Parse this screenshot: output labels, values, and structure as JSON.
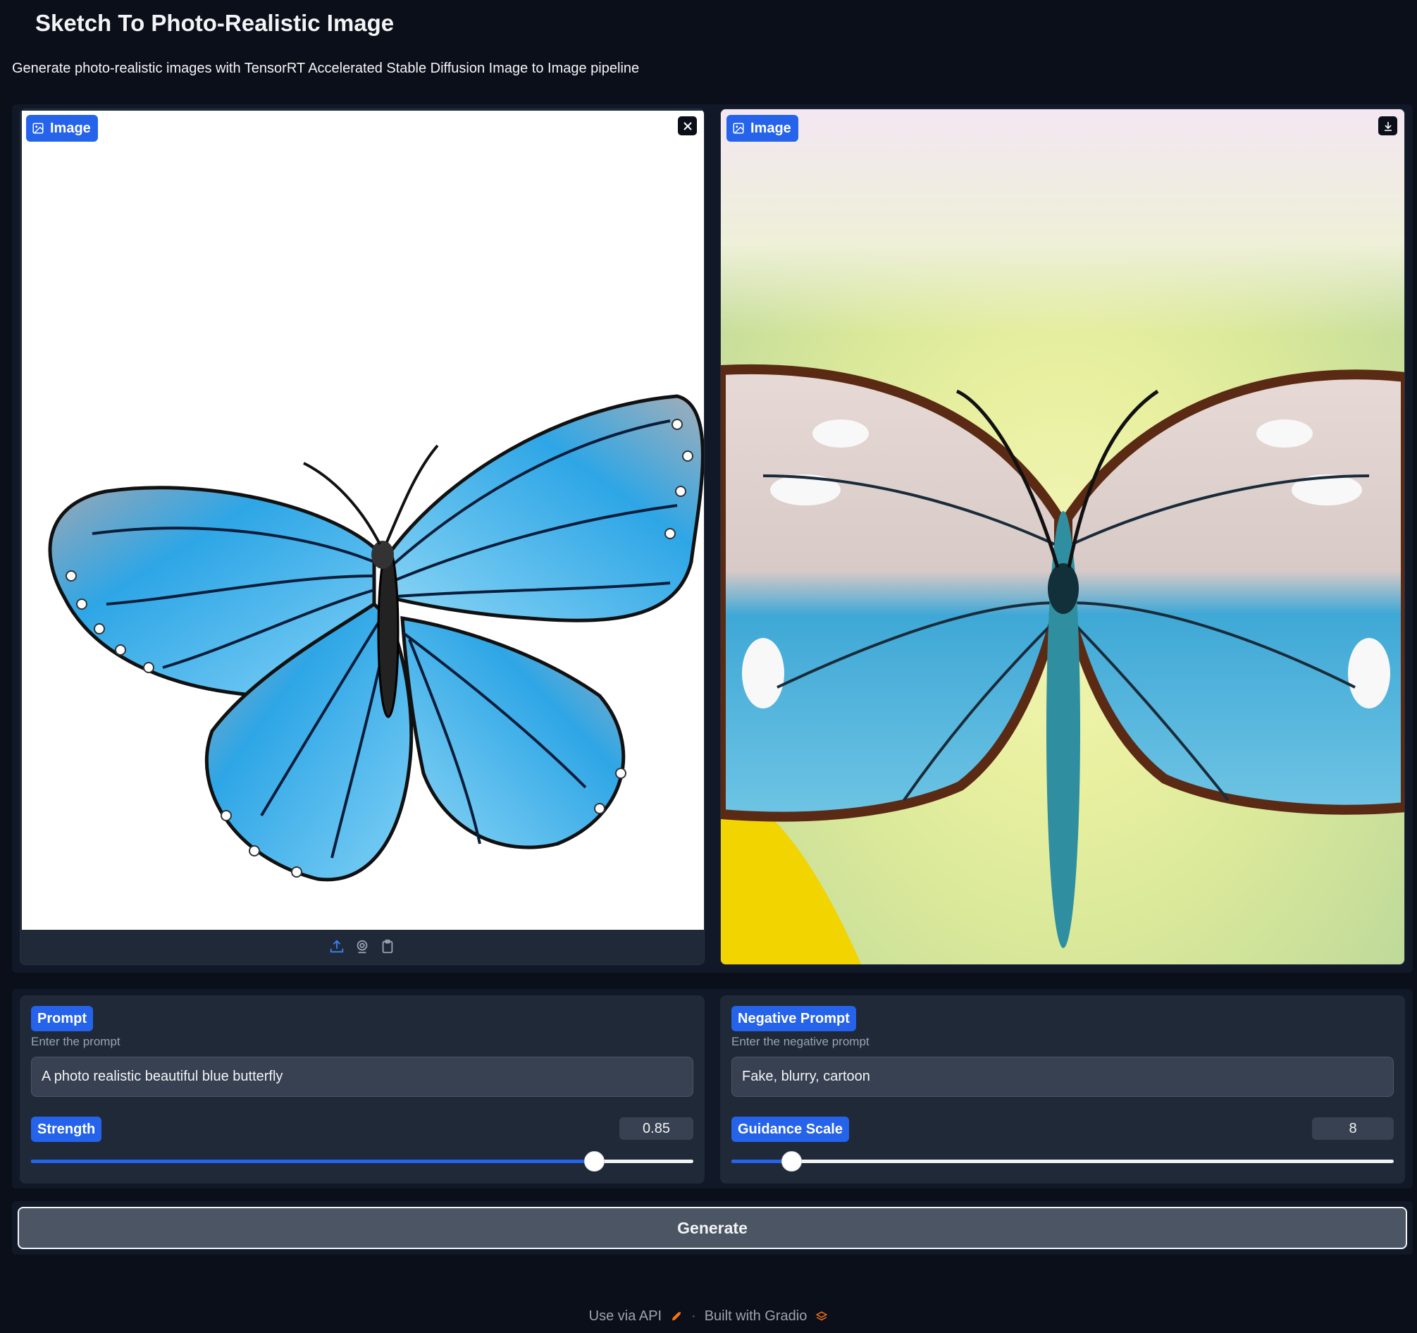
{
  "header": {
    "title": "Sketch To Photo-Realistic Image",
    "subtitle": "Generate photo-realistic images with TensorRT Accelerated Stable Diffusion Image to Image pipeline"
  },
  "input_image": {
    "label": "Image",
    "toolbar_icons": [
      "upload-icon",
      "webcam-icon",
      "clipboard-icon"
    ],
    "clear_icon": "close-icon"
  },
  "output_image": {
    "label": "Image",
    "download_icon": "download-icon"
  },
  "prompt": {
    "label": "Prompt",
    "hint": "Enter the prompt",
    "value": "A photo realistic beautiful blue butterfly"
  },
  "negative_prompt": {
    "label": "Negative Prompt",
    "hint": "Enter the negative prompt",
    "value": "Fake, blurry, cartoon"
  },
  "strength": {
    "label": "Strength",
    "value": "0.85",
    "fraction": 0.85
  },
  "guidance_scale": {
    "label": "Guidance Scale",
    "value": "8",
    "fraction": 0.09
  },
  "generate_label": "Generate",
  "footer": {
    "api_label": "Use via API",
    "built_label": "Built with Gradio"
  },
  "colors": {
    "background": "#0b0f19",
    "panel": "#1f2937",
    "accent": "#2563eb"
  }
}
